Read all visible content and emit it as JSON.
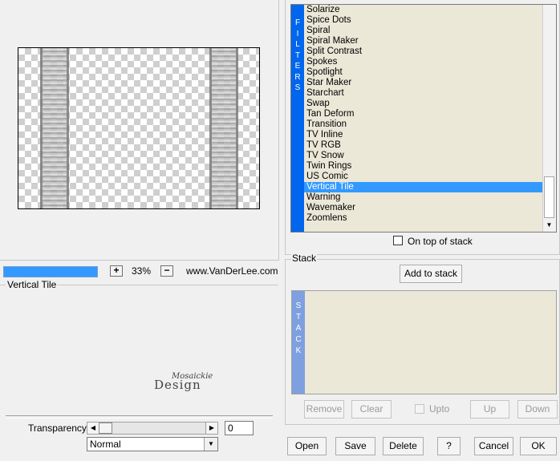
{
  "preview": {
    "zoom": "33%",
    "zoom_in": "+",
    "zoom_out": "−",
    "site": "www.VanDerLee.com",
    "progress": 1.0
  },
  "filter_panel": {
    "name": "Vertical Tile",
    "logo_top": "Mosaickie",
    "logo_bottom": "Design",
    "transparency_label": "Transparency",
    "transparency_value": "0",
    "blend_mode": "Normal"
  },
  "filters": {
    "sidebar": "F\nI\nL\nT\nE\nR\nS",
    "items": [
      "Solarize",
      "Spice Dots",
      "Spiral",
      "Spiral Maker",
      "Split Contrast",
      "Spokes",
      "Spotlight",
      "Star Maker",
      "Starchart",
      "Swap",
      "Tan Deform",
      "Transition",
      "TV Inline",
      "TV RGB",
      "TV Snow",
      "Twin Rings",
      "US Comic",
      "Vertical Tile",
      "Warning",
      "Wavemaker",
      "Zoomlens"
    ],
    "selected": "Vertical Tile",
    "on_top_label": "On top of stack",
    "on_top_checked": false
  },
  "stack": {
    "title": "Stack",
    "add_label": "Add to stack",
    "sidebar": "S\nT\nA\nC\nK",
    "remove_label": "Remove",
    "clear_label": "Clear",
    "upto_label": "Upto",
    "up_label": "Up",
    "down_label": "Down"
  },
  "buttons": {
    "open": "Open",
    "save": "Save",
    "delete": "Delete",
    "help": "?",
    "cancel": "Cancel",
    "ok": "OK"
  },
  "colors": {
    "accent": "#3399ff",
    "filters_sidebar": "#0066ee",
    "stack_sidebar": "#7fa0e0",
    "list_bg": "#ebe8d8"
  }
}
